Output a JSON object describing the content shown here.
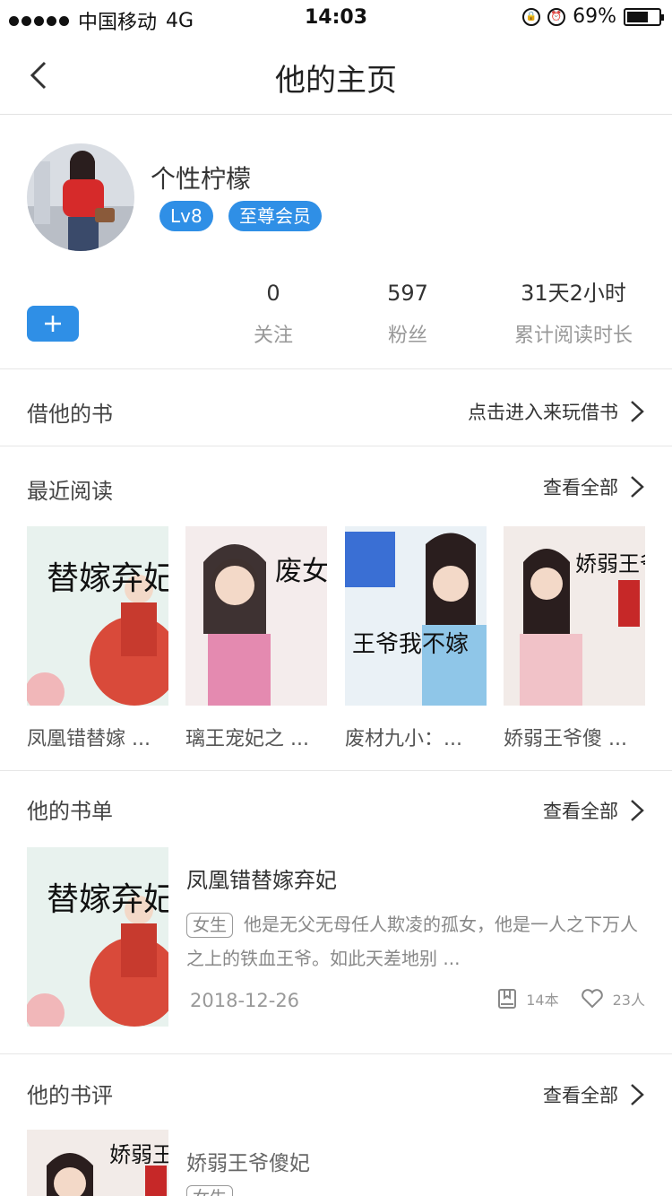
{
  "status_bar": {
    "carrier": "中国移动",
    "network": "4G",
    "time": "14:03",
    "battery_percent": "69%",
    "battery_level": 0.69
  },
  "nav": {
    "title": "他的主页",
    "back_icon": "chevron-left-icon"
  },
  "profile": {
    "username": "个性柠檬",
    "level_badge": "Lv8",
    "vip_badge": "至尊会员",
    "add_icon": "plus-icon",
    "stats": [
      {
        "value": "0",
        "label": "关注"
      },
      {
        "value": "597",
        "label": "粉丝"
      },
      {
        "value": "31天2小时",
        "label": "累计阅读时长"
      }
    ]
  },
  "borrow": {
    "title": "借他的书",
    "link": "点击进入来玩借书"
  },
  "recent": {
    "title": "最近阅读",
    "link": "查看全部",
    "books": [
      {
        "name": "凤凰错替嫁 ...",
        "cover_text": "替嫁弃妃"
      },
      {
        "name": "璃王宠妃之 ...",
        "cover_text": "废女成凰"
      },
      {
        "name": "废材九小：...",
        "cover_text": "王爷我不嫁"
      },
      {
        "name": "娇弱王爷傻 ...",
        "cover_text": "娇弱王爷"
      }
    ]
  },
  "booklist": {
    "title": "他的书单",
    "link": "查看全部",
    "item": {
      "name": "凤凰错替嫁弃妃",
      "tag": "女生",
      "desc": "他是无父无母任人欺凌的孤女，他是一人之下万人之上的铁血王爷。如此天差地别 ...",
      "date": "2018-12-26",
      "book_count": "14本",
      "likes": "23人"
    }
  },
  "reviews": {
    "title": "他的书评",
    "link": "查看全部",
    "item": {
      "book": "娇弱王爷傻妃",
      "tag": "女生"
    }
  },
  "colors": {
    "accent": "#2f8fe6",
    "divider": "#e6e6e6"
  }
}
